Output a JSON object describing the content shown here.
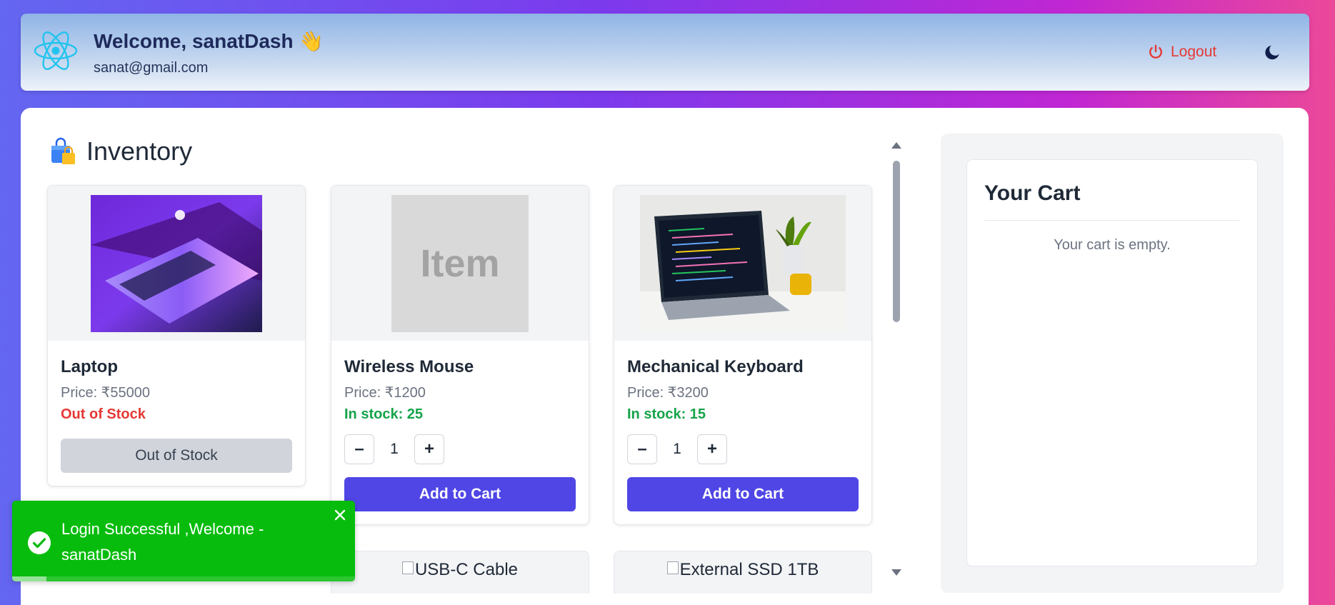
{
  "header": {
    "welcome": "Welcome, sanatDash 👋",
    "email": "sanat@gmail.com",
    "logout_label": "Logout",
    "logo_icon": "react-logo-icon",
    "theme_icon": "moon-icon"
  },
  "inventory": {
    "title": "Inventory",
    "title_icon": "shopping-bag-icon",
    "products": [
      {
        "name": "Laptop",
        "price": "Price: ₹55000",
        "stock": "Out of Stock",
        "button": "Out of Stock"
      },
      {
        "name": "Wireless Mouse",
        "price": "Price: ₹1200",
        "stock": "In stock: 25",
        "qty": "1",
        "button": "Add to Cart",
        "image_text": "Item"
      },
      {
        "name": "Mechanical Keyboard",
        "price": "Price: ₹3200",
        "stock": "In stock: 15",
        "qty": "1",
        "button": "Add to Cart"
      }
    ],
    "partial_products": [
      {
        "alt": "USB-C Cable"
      },
      {
        "alt": "External SSD 1TB"
      }
    ]
  },
  "cart": {
    "title": "Your Cart",
    "empty_text": "Your cart is empty."
  },
  "toast": {
    "message": "Login Successful ,Welcome - sanatDash",
    "progress": 0.1
  },
  "colors": {
    "primary": "#4f46e5",
    "success": "#16a34a",
    "danger": "#e53935",
    "toast": "#07bc0c"
  }
}
